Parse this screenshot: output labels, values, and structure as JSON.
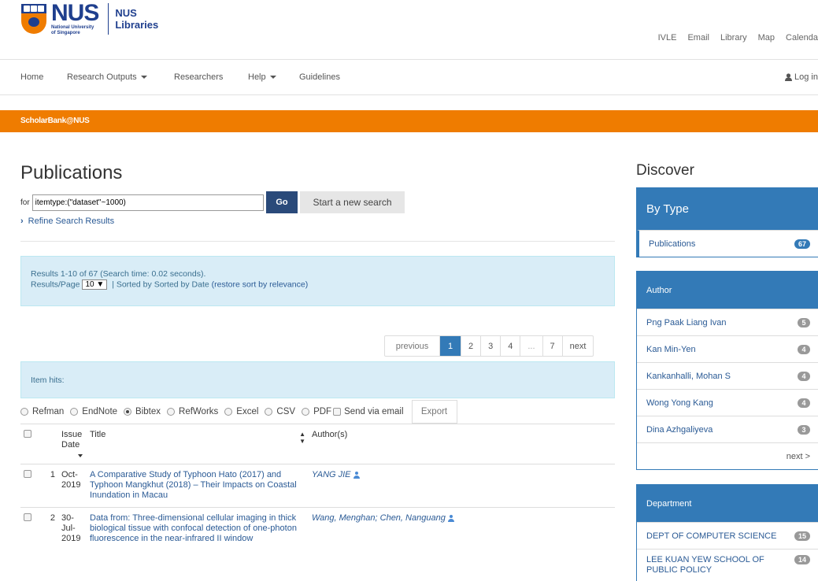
{
  "brand": {
    "nus": "NUS",
    "nus_sub1": "National University",
    "nus_sub2": "of Singapore",
    "lib1": "NUS",
    "lib2": "Libraries"
  },
  "toplinks": [
    "IVLE",
    "Email",
    "Library",
    "Map",
    "Calenda"
  ],
  "nav": {
    "home": "Home",
    "research_outputs": "Research Outputs",
    "researchers": "Researchers",
    "help": "Help",
    "guidelines": "Guidelines",
    "login": "Log in"
  },
  "banner": "ScholarBank@NUS",
  "search": {
    "title": "Publications",
    "for_label": "for",
    "query": "itemtype:(\"dataset\"~1000)",
    "go": "Go",
    "new_search": "Start a new search",
    "refine": "Refine Search Results"
  },
  "results": {
    "summary": "Results 1-10 of 67 (Search time: 0.02 seconds).",
    "rpp_label": "Results/Page",
    "rpp_value": "10 ▼",
    "sort_text": "| Sorted by Sorted by Date",
    "restore": "(restore sort by relevance)"
  },
  "pager": {
    "previous": "previous",
    "pages": [
      "1",
      "2",
      "3",
      "4",
      "...",
      "7"
    ],
    "next": "next",
    "current": 1
  },
  "item_hits": "Item hits:",
  "export": {
    "options": [
      "Refman",
      "EndNote",
      "Bibtex",
      "RefWorks",
      "Excel",
      "CSV",
      "PDF"
    ],
    "selected": "Bibtex",
    "send_email": "Send via email",
    "button": "Export"
  },
  "table": {
    "headers": {
      "issue": "Issue Date",
      "title": "Title",
      "authors": "Author(s)"
    },
    "rows": [
      {
        "num": "1",
        "date": "Oct-2019",
        "title": "A Comparative Study of Typhoon Hato (2017) and Typhoon Mangkhut (2018) – Their Impacts on Coastal Inundation in Macau",
        "authors": "YANG JIE"
      },
      {
        "num": "2",
        "date": "30-Jul-2019",
        "title": "Data from: Three-dimensional cellular imaging in thick biological tissue with confocal detection of one-photon fluorescence in the near-infrared II window",
        "authors": "Wang, Menghan; Chen, Nanguang"
      }
    ]
  },
  "sidebar": {
    "discover": "Discover",
    "by_type": {
      "header": "By Type",
      "items": [
        {
          "label": "Publications",
          "count": "67"
        }
      ]
    },
    "author": {
      "header": "Author",
      "items": [
        {
          "label": "Png Paak Liang Ivan",
          "count": "5"
        },
        {
          "label": "Kan Min-Yen",
          "count": "4"
        },
        {
          "label": "Kankanhalli, Mohan S",
          "count": "4"
        },
        {
          "label": "Wong Yong Kang",
          "count": "4"
        },
        {
          "label": "Dina Azhgaliyeva",
          "count": "3"
        }
      ],
      "next": "next >"
    },
    "department": {
      "header": "Department",
      "items": [
        {
          "label": "DEPT OF COMPUTER SCIENCE",
          "count": "15"
        },
        {
          "label": "LEE KUAN YEW SCHOOL OF PUBLIC POLICY",
          "count": "14"
        }
      ]
    }
  },
  "colors": {
    "orange": "#ef7c00",
    "blue": "#337ab7",
    "navy": "#1f3f8e"
  }
}
